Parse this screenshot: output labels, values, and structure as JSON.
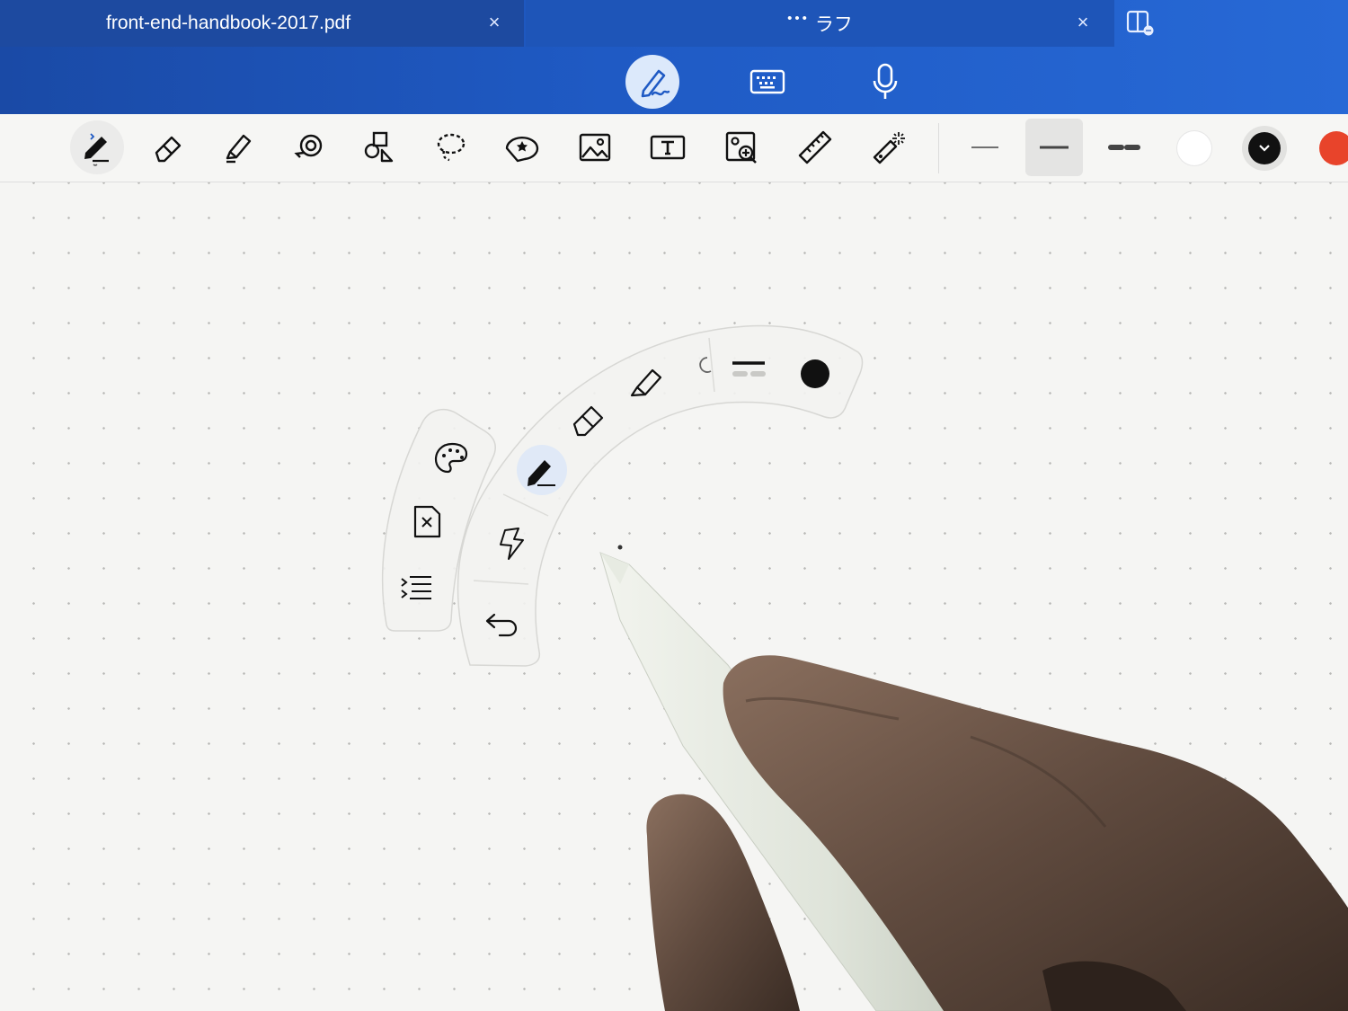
{
  "tabs": [
    {
      "label": "front-end-handbook-2017.pdf",
      "close": "×"
    },
    {
      "dots": "•••",
      "label": "ラフ",
      "close": "×"
    }
  ],
  "input_modes": [
    "pen",
    "keyboard",
    "microphone"
  ],
  "toolbar": {
    "tools": [
      "pen-tool",
      "eraser",
      "highlighter",
      "lasso-shape",
      "shapes",
      "lasso-select",
      "sticker",
      "image",
      "text-box",
      "image-search",
      "ruler",
      "laser-pointer"
    ],
    "stroke_widths": [
      "thin",
      "medium",
      "dashed"
    ],
    "selected_stroke": "medium",
    "swatches": [
      {
        "name": "white",
        "color": "#ffffff"
      },
      {
        "name": "black",
        "color": "#111111",
        "selected": true
      },
      {
        "name": "orange-red",
        "color": "#e8442b"
      }
    ]
  },
  "radial_menu": {
    "outer_items": [
      "pen",
      "eraser",
      "highlighter",
      "lasso",
      "stroke-width",
      "color"
    ],
    "current_color": "#111111",
    "inner_items": [
      "shortcut",
      "undo"
    ],
    "side_items": [
      "palette",
      "clear-page",
      "list"
    ]
  },
  "colors": {
    "accent_blue": "#1f5ac4",
    "pen_mode_highlight": "#dce9fb"
  }
}
